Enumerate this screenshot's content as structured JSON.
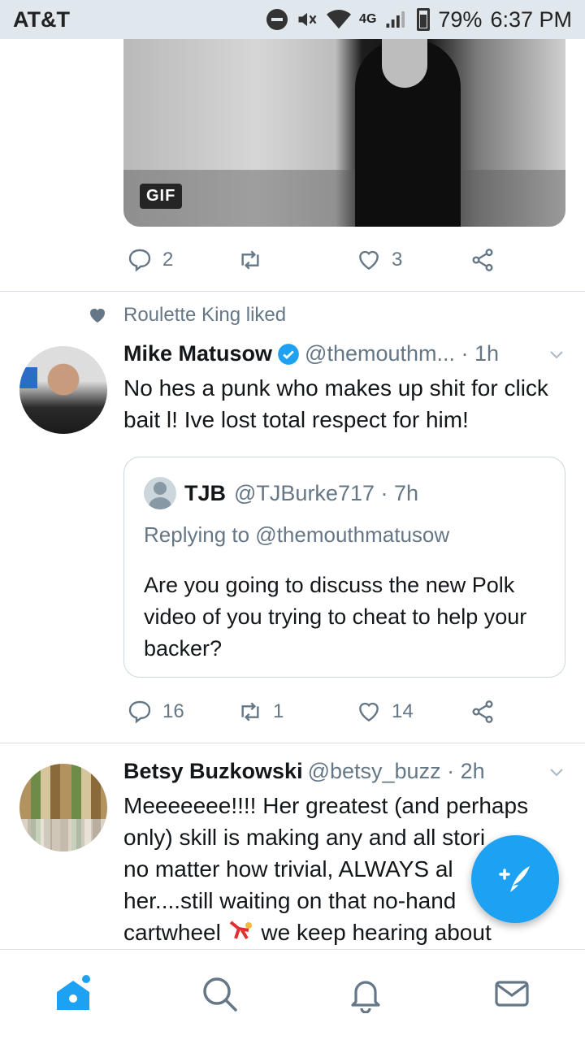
{
  "status_bar": {
    "carrier": "AT&T",
    "network": "4G",
    "battery": "79%",
    "time": "6:37 PM"
  },
  "gif_tweet": {
    "media_badge": "GIF",
    "replies": "2",
    "retweets": "",
    "likes": "3"
  },
  "social_context": {
    "text": "Roulette King liked"
  },
  "tweet1": {
    "name": "Mike Matusow",
    "handle": "@themouthm... · 1h",
    "text": "No hes a punk who makes up shit for click bait l! Ive lost total respect for him!",
    "quote": {
      "name": "TJB",
      "handle": "@TJBurke717 · 7h",
      "reply_to": "Replying to @themouthmatusow",
      "text": "Are you going to discuss the new Polk video of you trying to cheat to help your backer?"
    },
    "replies": "16",
    "retweets": "1",
    "likes": "14"
  },
  "tweet2": {
    "name": "Betsy Buzkowski",
    "handle": "@betsy_buzz · 2h",
    "text_lines": [
      "Meeeeeee!!!! Her greatest (and perhaps",
      "only) skill is making any and all stori",
      "no matter how trivial, ALWAYS al",
      "her....still waiting on that no-hand",
      "cartwheel",
      "we keep hearing about"
    ]
  },
  "icons": {
    "home": "home-icon",
    "search": "search-icon",
    "notifications": "bell-icon",
    "messages": "envelope-icon",
    "compose": "compose-icon"
  },
  "colors": {
    "accent": "#1da1f2",
    "muted": "#657786"
  }
}
